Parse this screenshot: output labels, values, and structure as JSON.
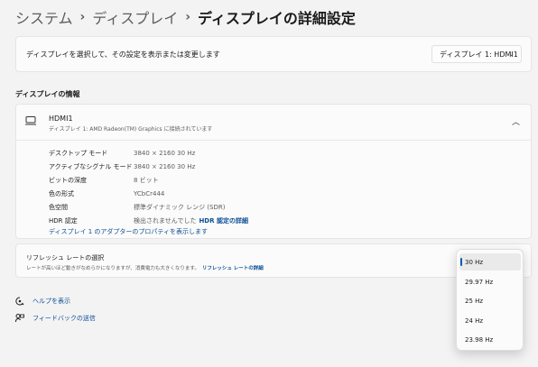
{
  "breadcrumb": {
    "item1": "システム",
    "item2": "ディスプレイ",
    "current": "ディスプレイの詳細設定",
    "separator": "›"
  },
  "display_select": {
    "description": "ディスプレイを選択して、その設定を表示または変更します",
    "dropdown_value": "ディスプレイ 1: HDMI1"
  },
  "display_info": {
    "section_title": "ディスプレイの情報",
    "name": "HDMI1",
    "subtitle": "ディスプレイ 1: AMD Radeon(TM) Graphics に接続されています",
    "properties": [
      {
        "label": "デスクトップ モード",
        "value": "3840 × 2160 30 Hz"
      },
      {
        "label": "アクティブなシグナル モード",
        "value": "3840 × 2160 30 Hz"
      },
      {
        "label": "ビットの深度",
        "value": "8 ビット"
      },
      {
        "label": "色の形式",
        "value": "YCbCr444"
      },
      {
        "label": "色空間",
        "value": "標準ダイナミック レンジ (SDR)"
      },
      {
        "label": "HDR 認定",
        "value": "検出されませんでした",
        "link": "HDR 認定の詳細"
      }
    ],
    "adapter_link": "ディスプレイ 1 のアダプターのプロパティを表示します"
  },
  "refresh_rate": {
    "title": "リフレッシュ レートの選択",
    "description": "レートが高いほど動きがなめらかになりますが、消費電力も大きくなります。",
    "link": "リフレッシュ レートの詳細",
    "options": [
      "30 Hz",
      "29.97 Hz",
      "25 Hz",
      "24 Hz",
      "23.98 Hz"
    ],
    "selected": "30 Hz"
  },
  "bottom_links": {
    "help": "ヘルプを表示",
    "feedback": "フィードバックの送信"
  },
  "colors": {
    "accent": "#0b5cad",
    "link": "#0b4e95",
    "background": "#f3f3f3",
    "card": "#fbfbfb"
  }
}
